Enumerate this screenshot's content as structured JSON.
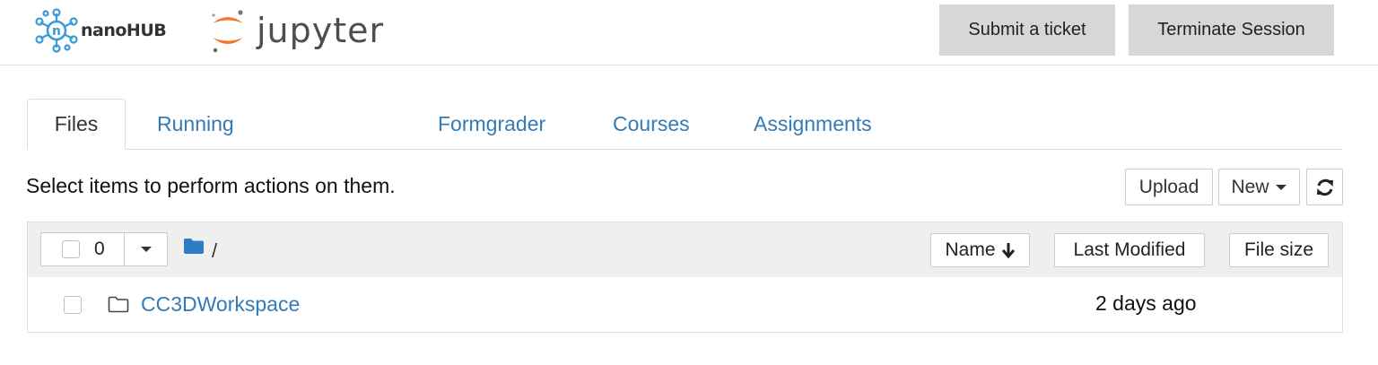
{
  "header": {
    "nanohub_logo_text": "nanoHUB",
    "jupyter_logo_text": "jupyter",
    "submit_ticket_label": "Submit a ticket",
    "terminate_session_label": "Terminate Session",
    "button_bg": "#d7d7d7"
  },
  "tabs": [
    {
      "label": "Files",
      "active": true
    },
    {
      "label": "Running",
      "active": false
    },
    {
      "label": "Formgrader",
      "active": false
    },
    {
      "label": "Courses",
      "active": false
    },
    {
      "label": "Assignments",
      "active": false
    }
  ],
  "toolbar": {
    "hint": "Select items to perform actions on them.",
    "upload_label": "Upload",
    "new_label": "New",
    "icons": {
      "new_caret": "caret-down-icon",
      "refresh": "refresh-icon"
    }
  },
  "list": {
    "selected_count": "0",
    "breadcrumb": "/",
    "columns": {
      "name": "Name",
      "last_modified": "Last Modified",
      "file_size": "File size"
    },
    "items": [
      {
        "name": "CC3DWorkspace",
        "type": "folder",
        "modified": "2 days ago",
        "size": ""
      }
    ]
  },
  "colors": {
    "link": "#337ab7",
    "folder_icon": "#2f7bc4",
    "jupyter_orange": "#f37726",
    "nanohub_blue": "#3a9ad9"
  }
}
